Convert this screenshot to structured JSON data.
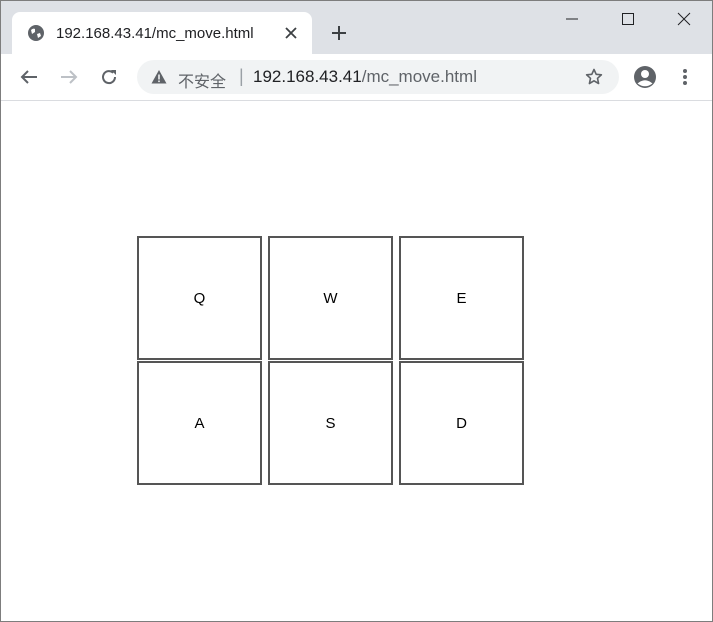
{
  "tab": {
    "title": "192.168.43.41/mc_move.html"
  },
  "omnibox": {
    "security_label": "不安全",
    "separator": "|",
    "url_host": "192.168.43.41",
    "url_path": "/mc_move.html"
  },
  "keys": {
    "q": "Q",
    "w": "W",
    "e": "E",
    "a": "A",
    "s": "S",
    "d": "D"
  }
}
